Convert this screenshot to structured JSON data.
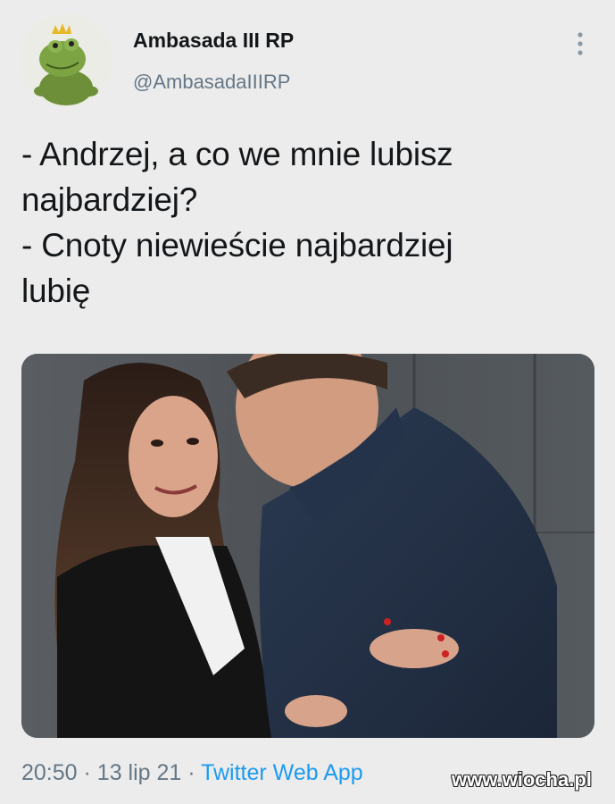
{
  "tweet": {
    "display_name": "Ambasada III RP",
    "handle": "@AmbasadaIIIRP",
    "avatar_icon": "frog-plush-icon",
    "more_icon": "more-vertical-icon",
    "text_lines": [
      "- Andrzej, a co we mnie lubisz",
      "najbardziej?",
      "- Cnoty niewieście najbardziej",
      "lubię"
    ],
    "time": "20:50",
    "date": "13 lip 21",
    "source": "Twitter Web App",
    "separator": "·"
  },
  "watermark": "www.wiocha.pl",
  "colors": {
    "link": "#1d9bf0",
    "secondary_text": "#657786",
    "background": "#ececec"
  }
}
